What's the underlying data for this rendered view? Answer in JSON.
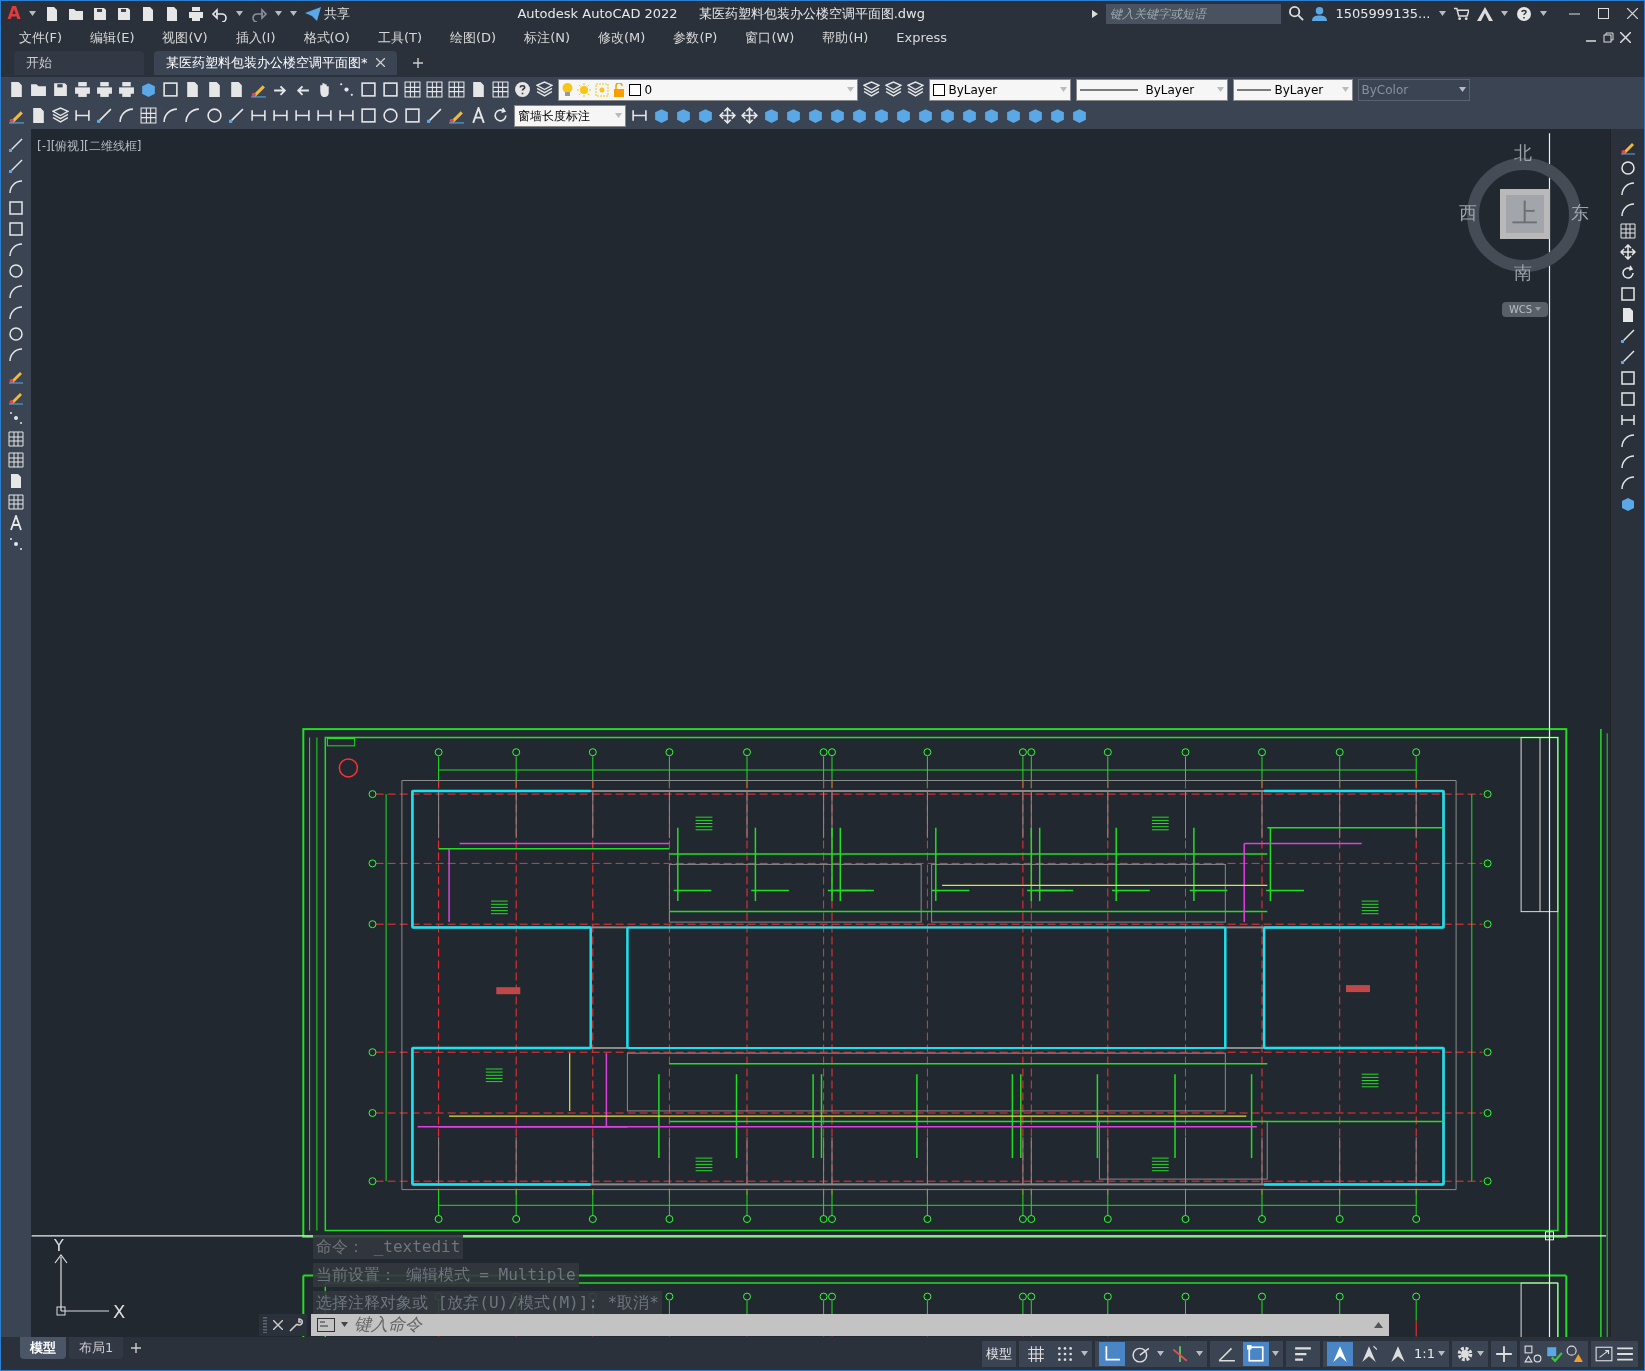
{
  "title_bar": {
    "app_button": "A",
    "share": "共享",
    "title": "Autodesk AutoCAD 2022",
    "file_name": "某医药塑料包装办公楼空调平面图.dwg",
    "search": {
      "placeholder": "键入关键字或短语"
    },
    "user": "1505999135..."
  },
  "menu": [
    "文件(F)",
    "编辑(E)",
    "视图(V)",
    "插入(I)",
    "格式(O)",
    "工具(T)",
    "绘图(D)",
    "标注(N)",
    "修改(M)",
    "参数(P)",
    "窗口(W)",
    "帮助(H)",
    "Express"
  ],
  "file_tabs": [
    {
      "label": "开始",
      "selected": false
    },
    {
      "label": "某医药塑料包装办公楼空调平面图*",
      "selected": true
    }
  ],
  "layer_toolbar": {
    "layer": "0",
    "color_setting": "ByLayer",
    "linetype": "ByLayer",
    "lineweight": "ByLayer",
    "plot_style": {
      "value": "ByColor",
      "disabled": true
    }
  },
  "dim_style": "窗墙长度标注",
  "viewport_label": "[-][俯视][二维线框]",
  "viewcube": {
    "north": "北",
    "south": "南",
    "east": "东",
    "west": "西",
    "face": "上",
    "ucs": "WCS"
  },
  "ucs_icon": {
    "x": "X",
    "y": "Y"
  },
  "command_history": [
    "命令： _textedit",
    "当前设置： 编辑模式 = Multiple",
    "选择注释对象或 [放弃(U)/模式(M)]: *取消*"
  ],
  "command_line": {
    "placeholder": "键入命令"
  },
  "layout_tabs": [
    {
      "label": "模型",
      "selected": true
    },
    {
      "label": "布局1",
      "selected": false
    }
  ],
  "status_bar": {
    "space": "模型",
    "scale": "1:1",
    "toggles": [
      {
        "kind": "grid",
        "on": false
      },
      {
        "kind": "snap",
        "on": false
      },
      {
        "kind": "ortho",
        "on": true
      },
      {
        "kind": "polar",
        "on": false
      },
      {
        "kind": "iso",
        "on": false
      },
      {
        "kind": "angle",
        "on": false
      },
      {
        "kind": "osnap",
        "on": true
      },
      {
        "kind": "lineweight",
        "on": false
      },
      {
        "kind": "annovis",
        "on": true
      },
      {
        "kind": "autoscale",
        "on": false
      },
      {
        "kind": "annoscale",
        "on": false
      }
    ]
  }
}
